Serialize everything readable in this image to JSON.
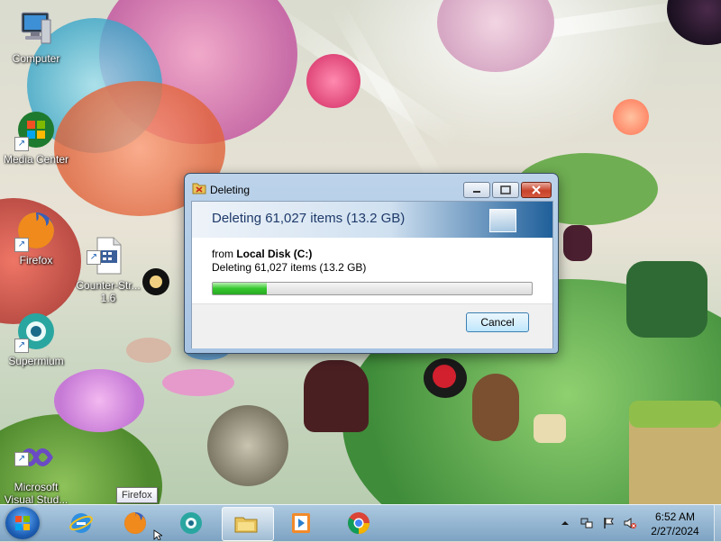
{
  "desktop": {
    "icons": [
      {
        "label": "Computer"
      },
      {
        "label": "Media Center"
      },
      {
        "label": "Firefox"
      },
      {
        "label": "Counter-Str...\n1.6"
      },
      {
        "label": "Supermium"
      },
      {
        "label": "Microsoft\nVisual Stud..."
      }
    ]
  },
  "dialog": {
    "title": "Deleting",
    "header": "Deleting 61,027 items (13.2 GB)",
    "from_prefix": "from ",
    "from_location": "Local Disk (C:)",
    "status": "Deleting 61,027 items (13.2 GB)",
    "progress": 0.17,
    "cancel_label": "Cancel"
  },
  "tooltip": {
    "text": "Firefox"
  },
  "taskbar": {
    "apps": [
      "Internet Explorer",
      "Firefox",
      "Supermium",
      "File Explorer",
      "Media Player",
      "Chrome"
    ],
    "active_app": "File Explorer",
    "clock": {
      "time": "6:52 AM",
      "date": "2/27/2024"
    }
  }
}
